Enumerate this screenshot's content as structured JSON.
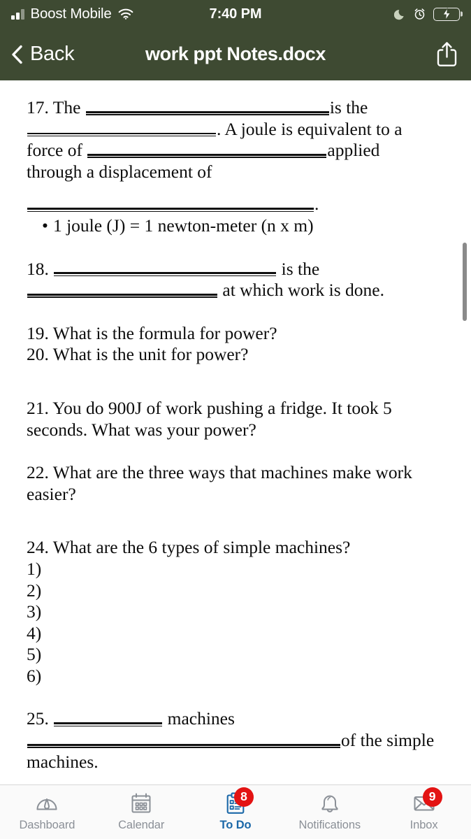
{
  "status_bar": {
    "carrier": "Boost Mobile",
    "time": "7:40 PM",
    "icons": {
      "signal": "signal-bars-icon",
      "wifi": "wifi-icon",
      "do_not_disturb": "moon-icon",
      "alarm": "alarm-clock-icon",
      "battery": "battery-charging-icon"
    },
    "battery_level_percent": 40,
    "battery_charging": true
  },
  "header": {
    "back_label": "Back",
    "title": "work ppt Notes.docx",
    "share_icon": "share-icon",
    "back_icon": "chevron-left-icon",
    "background_color": "#3e4a32"
  },
  "document": {
    "blocks": [
      {
        "id": "q17",
        "lines": [
          {
            "parts": [
              {
                "t": "text",
                "v": "17. The "
              },
              {
                "t": "blank",
                "w": "w-a"
              },
              {
                "t": "text",
                "v": "is the"
              }
            ]
          },
          {
            "parts": [
              {
                "t": "blank",
                "w": "w-b"
              },
              {
                "t": "text",
                "v": ". A joule is equivalent to a"
              }
            ]
          },
          {
            "parts": [
              {
                "t": "text",
                "v": "force of "
              },
              {
                "t": "blank",
                "w": "w-c"
              },
              {
                "t": "text",
                "v": "applied"
              }
            ]
          },
          {
            "parts": [
              {
                "t": "text",
                "v": "through a displacement of"
              }
            ]
          }
        ]
      },
      {
        "id": "q17-tail",
        "lines": [
          {
            "parts": [
              {
                "t": "blank",
                "w": "w-d"
              },
              {
                "t": "text",
                "v": "."
              }
            ]
          }
        ]
      },
      {
        "id": "q17-bullet",
        "bullet": "•",
        "text": "1 joule (J) = 1 newton-meter (n x m)"
      },
      {
        "id": "q18",
        "lines": [
          {
            "parts": [
              {
                "t": "text",
                "v": "18. "
              },
              {
                "t": "blank",
                "w": "w-e"
              },
              {
                "t": "text",
                "v": " is the"
              }
            ]
          },
          {
            "parts": [
              {
                "t": "blank",
                "w": "w-f"
              },
              {
                "t": "text",
                "v": " at which work is done."
              }
            ]
          }
        ]
      },
      {
        "id": "q19",
        "lines": [
          {
            "parts": [
              {
                "t": "text",
                "v": "19. What is the formula for power?"
              }
            ]
          },
          {
            "parts": [
              {
                "t": "text",
                "v": "20. What is the unit for power?"
              }
            ]
          }
        ]
      },
      {
        "id": "q21",
        "lines": [
          {
            "parts": [
              {
                "t": "text",
                "v": "21. You do 900J of work pushing a fridge. It took 5"
              }
            ]
          },
          {
            "parts": [
              {
                "t": "text",
                "v": "seconds. What was your power?"
              }
            ]
          }
        ]
      },
      {
        "id": "q22",
        "lines": [
          {
            "parts": [
              {
                "t": "text",
                "v": "22. What are the three ways that machines make work"
              }
            ]
          },
          {
            "parts": [
              {
                "t": "text",
                "v": "easier?"
              }
            ]
          }
        ]
      },
      {
        "id": "q24",
        "lines": [
          {
            "parts": [
              {
                "t": "text",
                "v": "24. What are the 6 types of simple machines?"
              }
            ]
          },
          {
            "parts": [
              {
                "t": "text",
                "v": "1)"
              }
            ]
          },
          {
            "parts": [
              {
                "t": "text",
                "v": "2)"
              }
            ]
          },
          {
            "parts": [
              {
                "t": "text",
                "v": "3)"
              }
            ]
          },
          {
            "parts": [
              {
                "t": "text",
                "v": "4)"
              }
            ]
          },
          {
            "parts": [
              {
                "t": "text",
                "v": "5)"
              }
            ]
          },
          {
            "parts": [
              {
                "t": "text",
                "v": "6)"
              }
            ]
          }
        ]
      },
      {
        "id": "q25",
        "lines": [
          {
            "parts": [
              {
                "t": "text",
                "v": "25. "
              },
              {
                "t": "blank",
                "w": "w-g"
              },
              {
                "t": "text",
                "v": " machines"
              }
            ]
          },
          {
            "parts": [
              {
                "t": "blank",
                "w": "w-h"
              },
              {
                "t": "text",
                "v": "of the simple"
              }
            ]
          },
          {
            "parts": [
              {
                "t": "text",
                "v": "machines."
              }
            ]
          }
        ]
      }
    ]
  },
  "tab_bar": {
    "active_color": "#1b68a8",
    "inactive_color": "#8b9097",
    "badge_color": "#e31313",
    "items": [
      {
        "label": "Dashboard",
        "icon": "gauge-icon",
        "active": false,
        "badge": null
      },
      {
        "label": "Calendar",
        "icon": "calendar-icon",
        "active": false,
        "badge": null
      },
      {
        "label": "To Do",
        "icon": "clipboard-icon",
        "active": true,
        "badge": "8"
      },
      {
        "label": "Notifications",
        "icon": "bell-icon",
        "active": false,
        "badge": null
      },
      {
        "label": "Inbox",
        "icon": "envelope-icon",
        "active": false,
        "badge": "9"
      }
    ]
  }
}
